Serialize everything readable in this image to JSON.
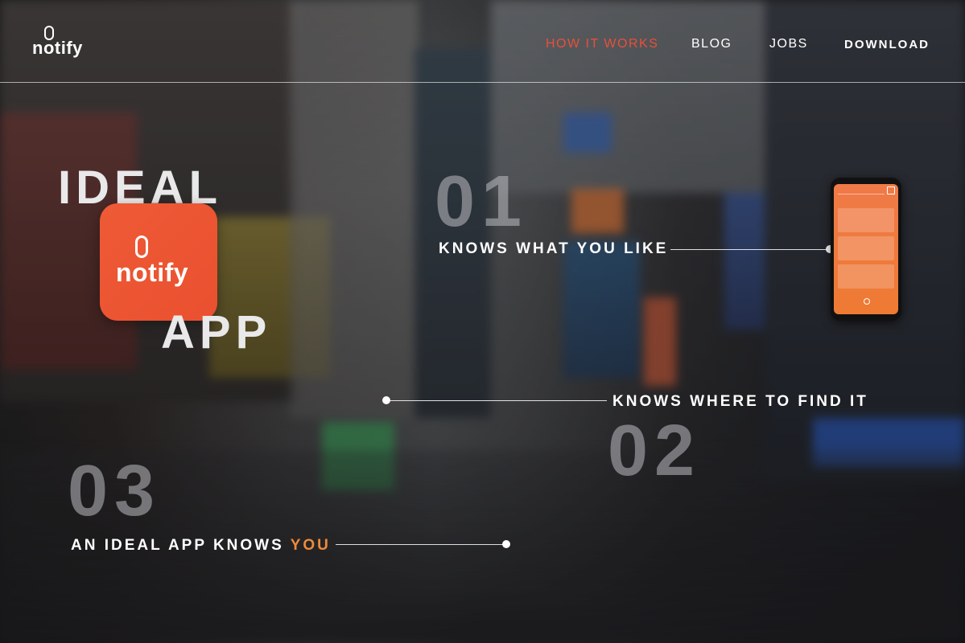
{
  "header": {
    "logo_text": "notify",
    "nav": [
      {
        "label": "HOW IT WORKS",
        "active": true
      },
      {
        "label": "BLOG",
        "active": false
      },
      {
        "label": "JOBS",
        "active": false
      },
      {
        "label": "DOWNLOAD",
        "active": false
      }
    ]
  },
  "hero": {
    "word_top": "IDEAL",
    "word_bottom": "APP",
    "app_icon_text": "notify"
  },
  "features": [
    {
      "number": "01",
      "text": "KNOWS WHAT YOU LIKE"
    },
    {
      "number": "02",
      "text": "KNOWS WHERE TO FIND IT"
    },
    {
      "number": "03",
      "text": "AN IDEAL APP KNOWS ",
      "accent": "YOU"
    }
  ],
  "colors": {
    "accent": "#e8503a",
    "highlight": "#f08a3a",
    "app_icon": "#ed5533"
  }
}
